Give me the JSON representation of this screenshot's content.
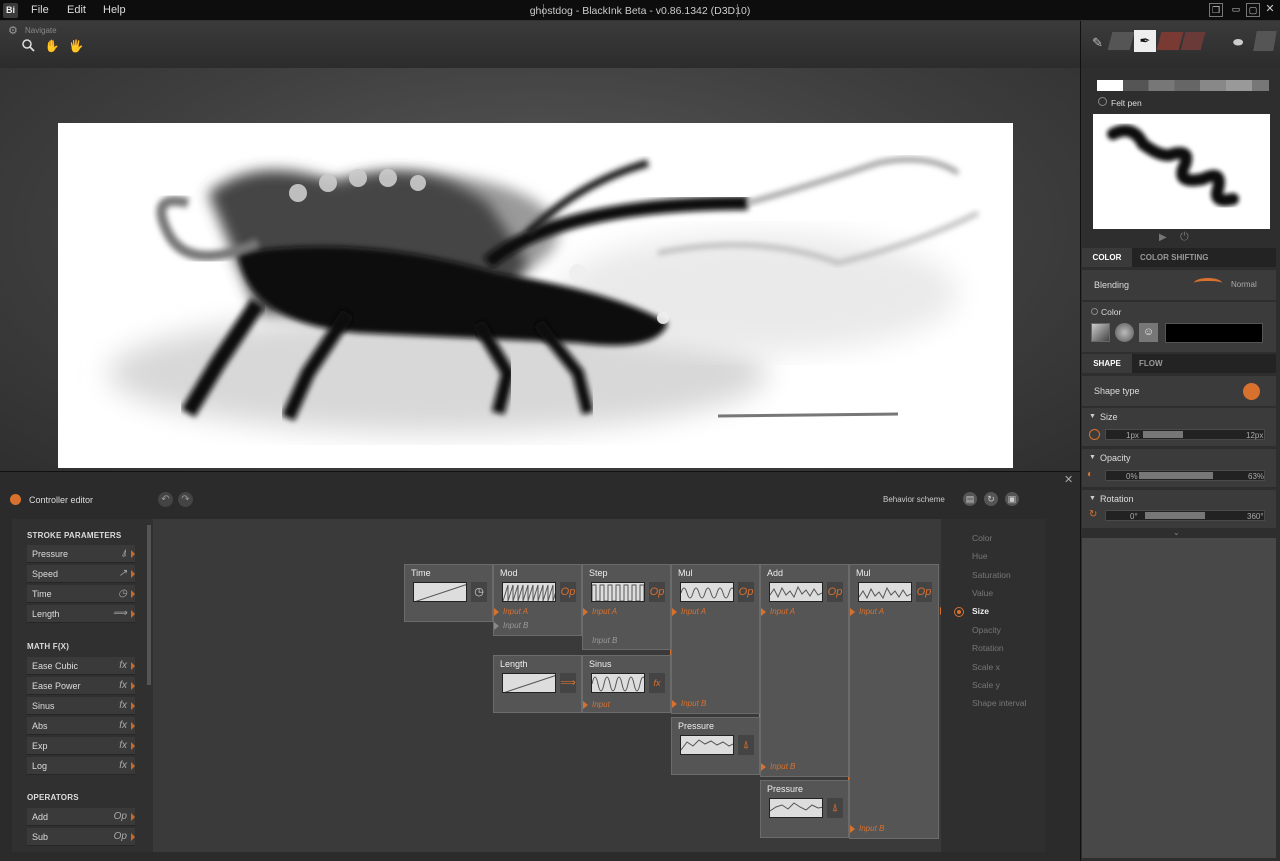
{
  "app": {
    "logo": "Bi",
    "window_title": "ghostdog - BlackInk Beta - v0.86.1342 (D3D10)",
    "menu": [
      "File",
      "Edit",
      "Help"
    ]
  },
  "navigate": {
    "label": "Navigate",
    "icons": [
      "zoom-icon",
      "hand-icon",
      "rotate-hand-icon"
    ]
  },
  "controller_editor": {
    "title": "Controller editor",
    "behavior_scheme_label": "Behavior scheme",
    "sections": [
      {
        "title": "STROKE PARAMETERS",
        "items": [
          {
            "label": "Pressure",
            "icon": "pressure-icon"
          },
          {
            "label": "Speed",
            "icon": "speed-icon"
          },
          {
            "label": "Time",
            "icon": "stopwatch-icon"
          },
          {
            "label": "Length",
            "icon": "length-icon"
          }
        ]
      },
      {
        "title": "MATH F(X)",
        "items": [
          {
            "label": "Ease Cubic",
            "icon": "fx-icon"
          },
          {
            "label": "Ease Power",
            "icon": "fx-icon"
          },
          {
            "label": "Sinus",
            "icon": "fx-icon"
          },
          {
            "label": "Abs",
            "icon": "fx-icon"
          },
          {
            "label": "Exp",
            "icon": "fx-icon"
          },
          {
            "label": "Log",
            "icon": "fx-icon"
          }
        ]
      },
      {
        "title": "OPERATORS",
        "items": [
          {
            "label": "Add",
            "icon": "op-icon"
          },
          {
            "label": "Sub",
            "icon": "op-icon"
          }
        ]
      }
    ],
    "nodes": {
      "time": {
        "title": "Time"
      },
      "mod": {
        "title": "Mod",
        "inputs": [
          "Input A",
          "Input B"
        ]
      },
      "step": {
        "title": "Step",
        "inputs": [
          "Input A",
          "Input B"
        ]
      },
      "mul1": {
        "title": "Mul",
        "inputs": [
          "Input A",
          "Input B"
        ]
      },
      "add": {
        "title": "Add",
        "inputs": [
          "Input A",
          "Input B"
        ]
      },
      "mul2": {
        "title": "Mul",
        "inputs": [
          "Input A",
          "Input B"
        ]
      },
      "length": {
        "title": "Length"
      },
      "sinus": {
        "title": "Sinus",
        "inputs": [
          "Input"
        ]
      },
      "pressure1": {
        "title": "Pressure"
      },
      "pressure2": {
        "title": "Pressure"
      }
    },
    "fx_glyph": "fx",
    "op_glyph": "Op",
    "targets": [
      "Color",
      "Hue",
      "Saturation",
      "Value",
      "Size",
      "Opacity",
      "Rotation",
      "Scale x",
      "Scale y",
      "Shape interval"
    ],
    "selected_target": "Size"
  },
  "brush": {
    "name": "Felt pen"
  },
  "color_panel": {
    "tabs": [
      "COLOR",
      "COLOR SHIFTING"
    ],
    "active_tab": "COLOR",
    "blending_label": "Blending",
    "blending_value": "Normal",
    "color_label": "Color",
    "swatch": "#000000"
  },
  "shape_panel": {
    "tabs": [
      "SHAPE",
      "FLOW"
    ],
    "active_tab": "SHAPE",
    "shape_type_label": "Shape type",
    "size": {
      "label": "Size",
      "min": "1px",
      "max": "12px",
      "fraction": 0.33
    },
    "opacity": {
      "label": "Opacity",
      "min": "0%",
      "max": "63%",
      "fraction": 0.62
    },
    "rotation": {
      "label": "Rotation",
      "min": "0°",
      "max": "360°",
      "fraction": 0.5
    }
  },
  "colors": {
    "accent": "#d9712e",
    "panel": "#2e2e2e",
    "node": "#555555"
  }
}
